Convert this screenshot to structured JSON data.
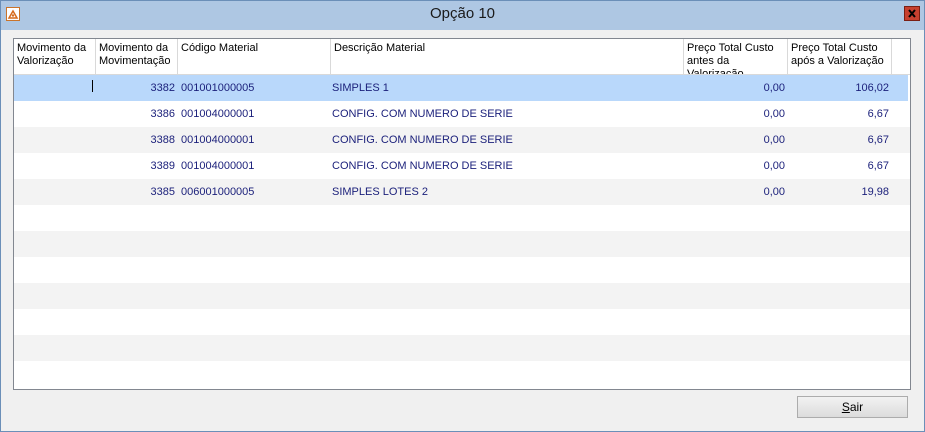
{
  "window": {
    "title": "Opção 10",
    "app_icon": "app-logo-icon",
    "close_icon": "close-icon"
  },
  "grid": {
    "columns": [
      "Movimento da\nValorização",
      "Movimento da\nMovimentação",
      "Código Material",
      "Descrição Material",
      "Preço Total Custo\nantes da Valorização",
      "Preço Total Custo\napós a Valorização"
    ],
    "rows": [
      {
        "mov_val": "",
        "mov_mov": "3382",
        "codigo": "001001000005",
        "descricao": "SIMPLES 1",
        "antes": "0,00",
        "apos": "106,02"
      },
      {
        "mov_val": "",
        "mov_mov": "3386",
        "codigo": "001004000001",
        "descricao": "CONFIG. COM NUMERO DE SERIE",
        "antes": "0,00",
        "apos": "6,67"
      },
      {
        "mov_val": "",
        "mov_mov": "3388",
        "codigo": "001004000001",
        "descricao": "CONFIG. COM NUMERO DE SERIE",
        "antes": "0,00",
        "apos": "6,67"
      },
      {
        "mov_val": "",
        "mov_mov": "3389",
        "codigo": "001004000001",
        "descricao": "CONFIG. COM NUMERO DE SERIE",
        "antes": "0,00",
        "apos": "6,67"
      },
      {
        "mov_val": "",
        "mov_mov": "3385",
        "codigo": "006001000005",
        "descricao": "SIMPLES LOTES 2",
        "antes": "0,00",
        "apos": "19,98"
      }
    ],
    "selected_row": 0
  },
  "footer": {
    "exit_button_accel": "S",
    "exit_button_rest": "air"
  }
}
